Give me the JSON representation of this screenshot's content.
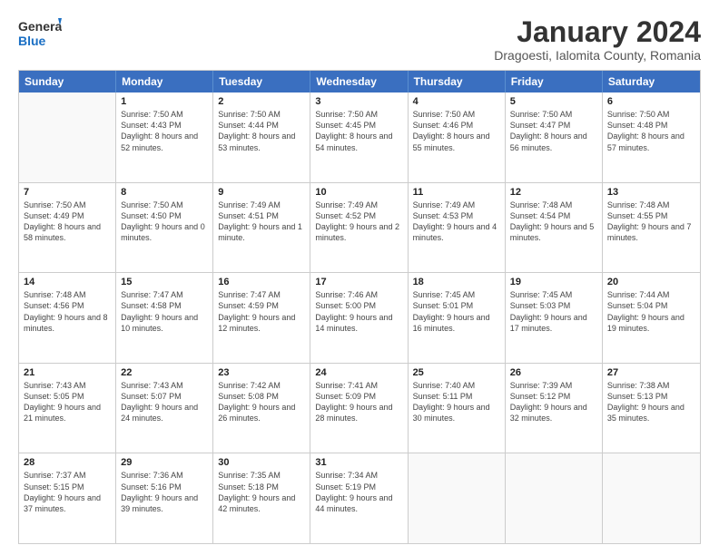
{
  "logo": {
    "general": "General",
    "blue": "Blue"
  },
  "title": "January 2024",
  "subtitle": "Dragoesti, Ialomita County, Romania",
  "days": [
    "Sunday",
    "Monday",
    "Tuesday",
    "Wednesday",
    "Thursday",
    "Friday",
    "Saturday"
  ],
  "weeks": [
    [
      {
        "day": "",
        "sunrise": "",
        "sunset": "",
        "daylight": ""
      },
      {
        "day": "1",
        "sunrise": "Sunrise: 7:50 AM",
        "sunset": "Sunset: 4:43 PM",
        "daylight": "Daylight: 8 hours and 52 minutes."
      },
      {
        "day": "2",
        "sunrise": "Sunrise: 7:50 AM",
        "sunset": "Sunset: 4:44 PM",
        "daylight": "Daylight: 8 hours and 53 minutes."
      },
      {
        "day": "3",
        "sunrise": "Sunrise: 7:50 AM",
        "sunset": "Sunset: 4:45 PM",
        "daylight": "Daylight: 8 hours and 54 minutes."
      },
      {
        "day": "4",
        "sunrise": "Sunrise: 7:50 AM",
        "sunset": "Sunset: 4:46 PM",
        "daylight": "Daylight: 8 hours and 55 minutes."
      },
      {
        "day": "5",
        "sunrise": "Sunrise: 7:50 AM",
        "sunset": "Sunset: 4:47 PM",
        "daylight": "Daylight: 8 hours and 56 minutes."
      },
      {
        "day": "6",
        "sunrise": "Sunrise: 7:50 AM",
        "sunset": "Sunset: 4:48 PM",
        "daylight": "Daylight: 8 hours and 57 minutes."
      }
    ],
    [
      {
        "day": "7",
        "sunrise": "Sunrise: 7:50 AM",
        "sunset": "Sunset: 4:49 PM",
        "daylight": "Daylight: 8 hours and 58 minutes."
      },
      {
        "day": "8",
        "sunrise": "Sunrise: 7:50 AM",
        "sunset": "Sunset: 4:50 PM",
        "daylight": "Daylight: 9 hours and 0 minutes."
      },
      {
        "day": "9",
        "sunrise": "Sunrise: 7:49 AM",
        "sunset": "Sunset: 4:51 PM",
        "daylight": "Daylight: 9 hours and 1 minute."
      },
      {
        "day": "10",
        "sunrise": "Sunrise: 7:49 AM",
        "sunset": "Sunset: 4:52 PM",
        "daylight": "Daylight: 9 hours and 2 minutes."
      },
      {
        "day": "11",
        "sunrise": "Sunrise: 7:49 AM",
        "sunset": "Sunset: 4:53 PM",
        "daylight": "Daylight: 9 hours and 4 minutes."
      },
      {
        "day": "12",
        "sunrise": "Sunrise: 7:48 AM",
        "sunset": "Sunset: 4:54 PM",
        "daylight": "Daylight: 9 hours and 5 minutes."
      },
      {
        "day": "13",
        "sunrise": "Sunrise: 7:48 AM",
        "sunset": "Sunset: 4:55 PM",
        "daylight": "Daylight: 9 hours and 7 minutes."
      }
    ],
    [
      {
        "day": "14",
        "sunrise": "Sunrise: 7:48 AM",
        "sunset": "Sunset: 4:56 PM",
        "daylight": "Daylight: 9 hours and 8 minutes."
      },
      {
        "day": "15",
        "sunrise": "Sunrise: 7:47 AM",
        "sunset": "Sunset: 4:58 PM",
        "daylight": "Daylight: 9 hours and 10 minutes."
      },
      {
        "day": "16",
        "sunrise": "Sunrise: 7:47 AM",
        "sunset": "Sunset: 4:59 PM",
        "daylight": "Daylight: 9 hours and 12 minutes."
      },
      {
        "day": "17",
        "sunrise": "Sunrise: 7:46 AM",
        "sunset": "Sunset: 5:00 PM",
        "daylight": "Daylight: 9 hours and 14 minutes."
      },
      {
        "day": "18",
        "sunrise": "Sunrise: 7:45 AM",
        "sunset": "Sunset: 5:01 PM",
        "daylight": "Daylight: 9 hours and 16 minutes."
      },
      {
        "day": "19",
        "sunrise": "Sunrise: 7:45 AM",
        "sunset": "Sunset: 5:03 PM",
        "daylight": "Daylight: 9 hours and 17 minutes."
      },
      {
        "day": "20",
        "sunrise": "Sunrise: 7:44 AM",
        "sunset": "Sunset: 5:04 PM",
        "daylight": "Daylight: 9 hours and 19 minutes."
      }
    ],
    [
      {
        "day": "21",
        "sunrise": "Sunrise: 7:43 AM",
        "sunset": "Sunset: 5:05 PM",
        "daylight": "Daylight: 9 hours and 21 minutes."
      },
      {
        "day": "22",
        "sunrise": "Sunrise: 7:43 AM",
        "sunset": "Sunset: 5:07 PM",
        "daylight": "Daylight: 9 hours and 24 minutes."
      },
      {
        "day": "23",
        "sunrise": "Sunrise: 7:42 AM",
        "sunset": "Sunset: 5:08 PM",
        "daylight": "Daylight: 9 hours and 26 minutes."
      },
      {
        "day": "24",
        "sunrise": "Sunrise: 7:41 AM",
        "sunset": "Sunset: 5:09 PM",
        "daylight": "Daylight: 9 hours and 28 minutes."
      },
      {
        "day": "25",
        "sunrise": "Sunrise: 7:40 AM",
        "sunset": "Sunset: 5:11 PM",
        "daylight": "Daylight: 9 hours and 30 minutes."
      },
      {
        "day": "26",
        "sunrise": "Sunrise: 7:39 AM",
        "sunset": "Sunset: 5:12 PM",
        "daylight": "Daylight: 9 hours and 32 minutes."
      },
      {
        "day": "27",
        "sunrise": "Sunrise: 7:38 AM",
        "sunset": "Sunset: 5:13 PM",
        "daylight": "Daylight: 9 hours and 35 minutes."
      }
    ],
    [
      {
        "day": "28",
        "sunrise": "Sunrise: 7:37 AM",
        "sunset": "Sunset: 5:15 PM",
        "daylight": "Daylight: 9 hours and 37 minutes."
      },
      {
        "day": "29",
        "sunrise": "Sunrise: 7:36 AM",
        "sunset": "Sunset: 5:16 PM",
        "daylight": "Daylight: 9 hours and 39 minutes."
      },
      {
        "day": "30",
        "sunrise": "Sunrise: 7:35 AM",
        "sunset": "Sunset: 5:18 PM",
        "daylight": "Daylight: 9 hours and 42 minutes."
      },
      {
        "day": "31",
        "sunrise": "Sunrise: 7:34 AM",
        "sunset": "Sunset: 5:19 PM",
        "daylight": "Daylight: 9 hours and 44 minutes."
      },
      {
        "day": "",
        "sunrise": "",
        "sunset": "",
        "daylight": ""
      },
      {
        "day": "",
        "sunrise": "",
        "sunset": "",
        "daylight": ""
      },
      {
        "day": "",
        "sunrise": "",
        "sunset": "",
        "daylight": ""
      }
    ]
  ]
}
